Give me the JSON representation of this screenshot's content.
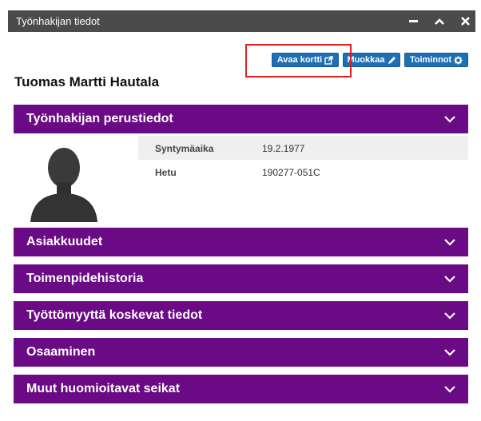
{
  "window": {
    "title": "Työnhakijan tiedot"
  },
  "toolbar": {
    "open_card_label": "Avaa kortti",
    "edit_label": "Muokkaa",
    "actions_label": "Toiminnot"
  },
  "person": {
    "name": "Tuomas Martti Hautala"
  },
  "sections": [
    {
      "title": "Työnhakijan perustiedot"
    },
    {
      "title": "Asiakkuudet"
    },
    {
      "title": "Toimenpidehistoria"
    },
    {
      "title": "Työttömyyttä koskevat tiedot"
    },
    {
      "title": "Osaaminen"
    },
    {
      "title": "Muut huomioitavat seikat"
    }
  ],
  "basic_info": [
    {
      "label": "Syntymäaika",
      "value": "19.2.1977"
    },
    {
      "label": "Hetu",
      "value": "190277-051C"
    }
  ],
  "colors": {
    "section": "#6b0a85",
    "button": "#1f6fb5",
    "titlebar": "#4b4b4b",
    "highlight": "#e02020"
  }
}
